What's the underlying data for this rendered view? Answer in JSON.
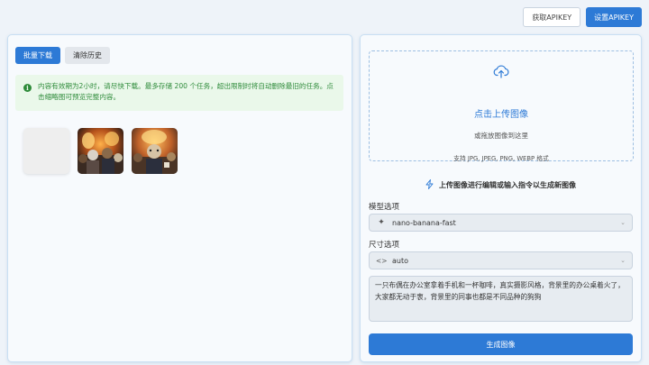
{
  "header": {
    "get_apikey_label": "获取APIKEY",
    "set_apikey_label": "设置APIKEY"
  },
  "history": {
    "tabs": [
      {
        "label": "批量下载",
        "active": true
      },
      {
        "label": "清除历史",
        "active": false
      }
    ],
    "notice_icon": "info-icon",
    "notice_text": "内容有效期为2小时，请尽快下载。最多存储 200 个任务，超出限制时将自动删除最旧的任务。点击缩略图可预览完整内容。"
  },
  "upload": {
    "icon": "cloud-upload-icon",
    "title": "点击上传图像",
    "subtitle": "或拖放图像到这里",
    "formats": "支持 JPG, JPEG, PNG, WEBP 格式"
  },
  "hint": {
    "icon": "lightning-icon",
    "text": "上传图像进行编辑或输入指令以生成新图像"
  },
  "model": {
    "label": "模型选项",
    "icon": "sparkle-icon",
    "value": "nano-banana-fast"
  },
  "size": {
    "label": "尺寸选项",
    "icon": "code-brackets-icon",
    "value": "auto"
  },
  "prompt": {
    "value": "一只布偶在办公室拿着手机和一杯咖啡，真实摄影风格，背景里的办公桌着火了，大家都无动于衷，背景里的同事也都是不同品种的狗狗"
  },
  "generate": {
    "label": "生成图像"
  },
  "colors": {
    "accent": "#2d7ad6",
    "notice_bg": "#eaf8ea",
    "notice_text": "#2e8b3a"
  }
}
